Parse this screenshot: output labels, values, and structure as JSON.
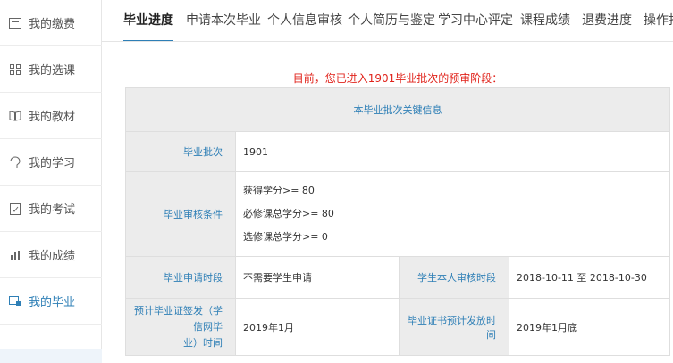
{
  "sidebar": {
    "items": [
      {
        "label": "我的缴费",
        "icon": "payment-icon"
      },
      {
        "label": "我的选课",
        "icon": "grid-icon"
      },
      {
        "label": "我的教材",
        "icon": "book-icon"
      },
      {
        "label": "我的学习",
        "icon": "learning-icon"
      },
      {
        "label": "我的考试",
        "icon": "exam-icon"
      },
      {
        "label": "我的成绩",
        "icon": "chart-icon"
      },
      {
        "label": "我的毕业",
        "icon": "graduation-icon"
      }
    ]
  },
  "tabs": [
    {
      "label": "毕业进度"
    },
    {
      "label": "申请本次毕业"
    },
    {
      "label": "个人信息审核"
    },
    {
      "label": "个人简历与鉴定"
    },
    {
      "label": "学习中心评定"
    },
    {
      "label": "课程成绩"
    },
    {
      "label": "退费进度"
    },
    {
      "label": "操作指"
    }
  ],
  "notice": "目前，您已进入1901毕业批次的预审阶段：",
  "table": {
    "caption": "本毕业批次关键信息",
    "batch_label": "毕业批次",
    "batch_value": "1901",
    "conditions_label": "毕业审核条件",
    "conditions": [
      "获得学分>= 80",
      "必修课总学分>= 80",
      "选修课总学分>= 0"
    ],
    "apply_period_label": "毕业申请时段",
    "apply_period_value": "不需要学生申请",
    "review_period_label": "学生本人审核时段",
    "review_period_value": "2018-10-11 至 2018-10-30",
    "cert_issue_label_line1": "预计毕业证签发（学信网毕",
    "cert_issue_label_line2": "业）时间",
    "cert_issue_value": "2019年1月",
    "cert_dist_label": "毕业证书预计发放时间",
    "cert_dist_value": "2019年1月底"
  },
  "colors": {
    "accent": "#2e7fb6",
    "notice": "#e0231b",
    "header_bg": "#ececec"
  }
}
